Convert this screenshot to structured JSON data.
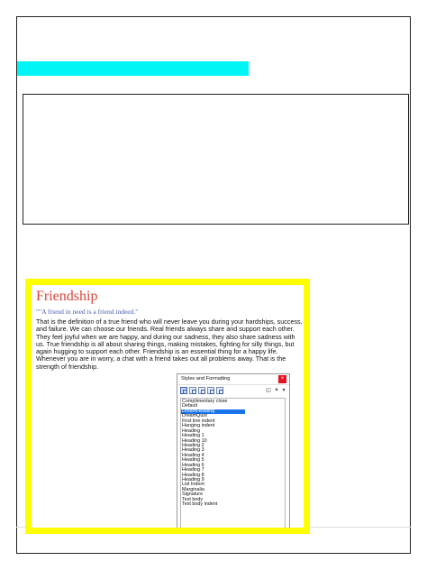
{
  "document": {
    "title": "Friendship",
    "quote": "\"\"A friend in need is a friend indeed.\"",
    "body": "That is the definition of a true friend who will never leave you during your hardships, success, and failure. We can choose our friends. Real friends always share and support each other. They feel joyful when we are happy, and during our sadness, they also share sadness with us. True friendship is all about sharing things, making mistakes, fighting for silly things, but again hugging to support each other. Friendship is an essential thing for a happy life. Whenever you are in worry, a chat with a friend takes out all problems away. That is the strength of friendship."
  },
  "styles_panel": {
    "title": "Styles and Formatting",
    "close_glyph": "×",
    "selected_index": 2,
    "items": [
      "Complimentary close",
      "Default",
      "DreamHeading",
      "DreamQuot",
      "First line indent",
      "Hanging indent",
      "Heading",
      "Heading 1",
      "Heading 10",
      "Heading 2",
      "Heading 3",
      "Heading 4",
      "Heading 5",
      "Heading 6",
      "Heading 7",
      "Heading 8",
      "Heading 9",
      "List Indent",
      "Marginalia",
      "Signature",
      "Text body",
      "Text body indent"
    ],
    "toolbar_icons": [
      "paragraph-styles-icon",
      "character-styles-icon",
      "frame-styles-icon",
      "page-styles-icon",
      "list-styles-icon",
      "fill-format-icon",
      "new-style-icon",
      "dropdown-icon"
    ]
  },
  "colors": {
    "highlight_bar": "#00f5f5",
    "frame": "#ffff00",
    "title": "#d9453a",
    "quote": "#4a5bb0",
    "selection": "#1a73e8"
  }
}
